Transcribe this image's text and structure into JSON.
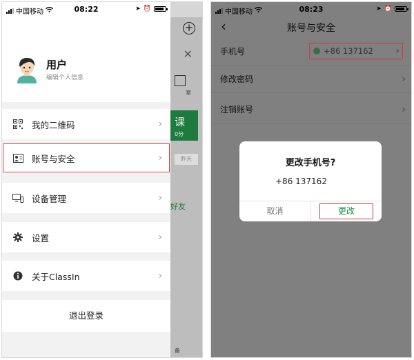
{
  "left_screen": {
    "status": {
      "carrier": "中国移动",
      "time": "08:22"
    },
    "background_page": {
      "green_card_text": "课",
      "green_card_sub": "0分",
      "chip_text": "昨天",
      "friend_text": "好友",
      "tiny_label": "室",
      "tab_label": "备"
    },
    "user": {
      "name": "用户",
      "subtitle": "编辑个人信息"
    },
    "menu": [
      {
        "label": "我的二维码",
        "icon": "qr-code-icon"
      },
      {
        "label": "账号与安全",
        "icon": "account-card-icon",
        "highlighted": true
      },
      {
        "label": "设备管理",
        "icon": "devices-icon"
      },
      {
        "label": "设置",
        "icon": "gear-icon"
      },
      {
        "label": "关于ClassIn",
        "icon": "info-icon"
      }
    ],
    "logout_label": "退出登录"
  },
  "right_screen": {
    "status": {
      "carrier": "中国移动",
      "time": "08:23"
    },
    "nav_title": "账号与安全",
    "rows": [
      {
        "label": "手机号",
        "value": "+86 137162"
      },
      {
        "label": "修改密码"
      },
      {
        "label": "注销账号"
      }
    ],
    "dialog": {
      "title": "更改手机号?",
      "message": "+86 137162",
      "cancel_label": "取消",
      "confirm_label": "更改"
    }
  },
  "colors": {
    "highlight_border": "#d33a3a",
    "brand_green": "#1a8f4a",
    "dim_overlay": "#808080"
  }
}
